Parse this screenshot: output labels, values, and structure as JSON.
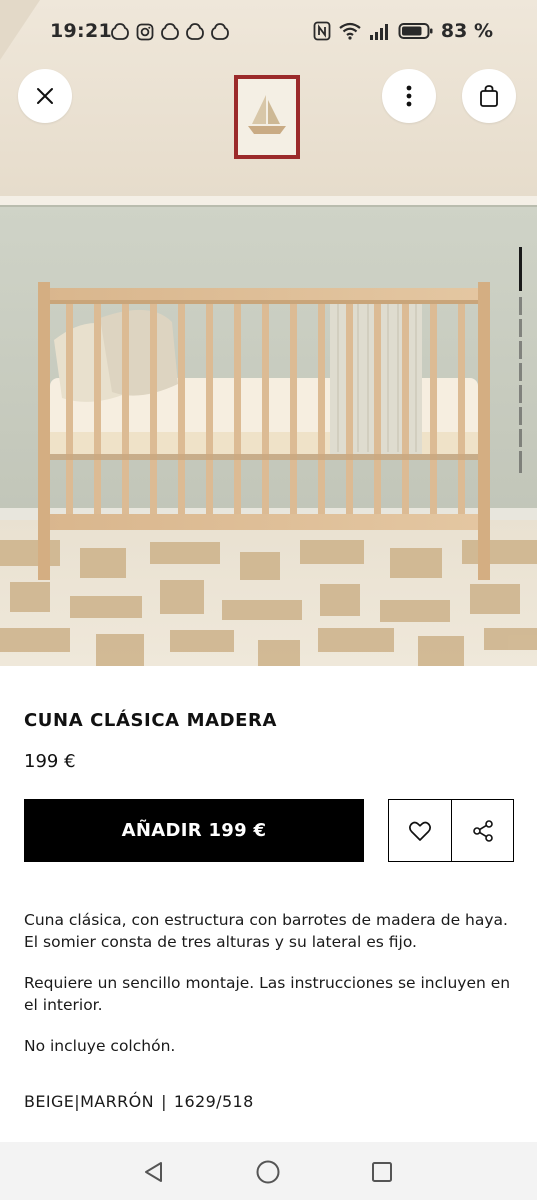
{
  "status_bar": {
    "time": "19:21",
    "battery_percent": "83 %",
    "notification_icons": [
      "app-notification-icon",
      "instagram-icon",
      "app-notification-icon",
      "app-notification-icon",
      "app-notification-icon"
    ],
    "right_icons": [
      "nfc-icon",
      "wifi-icon",
      "signal-icon",
      "battery-icon"
    ]
  },
  "top_actions": {
    "close_icon": "close-icon",
    "more_icon": "more-vertical-icon",
    "cart_icon": "shopping-bag-icon"
  },
  "gallery": {
    "image_count": 10,
    "active_index": 0
  },
  "product": {
    "title": "CUNA CLÁSICA MADERA",
    "price": "199 €",
    "add_button_label": "AÑADIR 199 €",
    "favorite_icon": "heart-icon",
    "share_icon": "share-icon",
    "description": [
      "Cuna clásica, con estructura con barrotes de madera de haya. El somier consta de tres alturas y su lateral es fijo.",
      "Requiere un sencillo montaje. Las instrucciones se incluyen en el interior.",
      "No incluye colchón."
    ],
    "color": "BEIGE|MARRÓN",
    "separator": "|",
    "reference": "1629/518"
  },
  "nav_bar": {
    "back_icon": "back-triangle-icon",
    "home_icon": "home-circle-icon",
    "recents_icon": "recents-square-icon"
  },
  "colors": {
    "wall": "#ede4d6",
    "wall_lower": "#c9cdc1",
    "wood": "#dcbb94",
    "button_black": "#000000",
    "nav_background": "#f3f3f3"
  }
}
